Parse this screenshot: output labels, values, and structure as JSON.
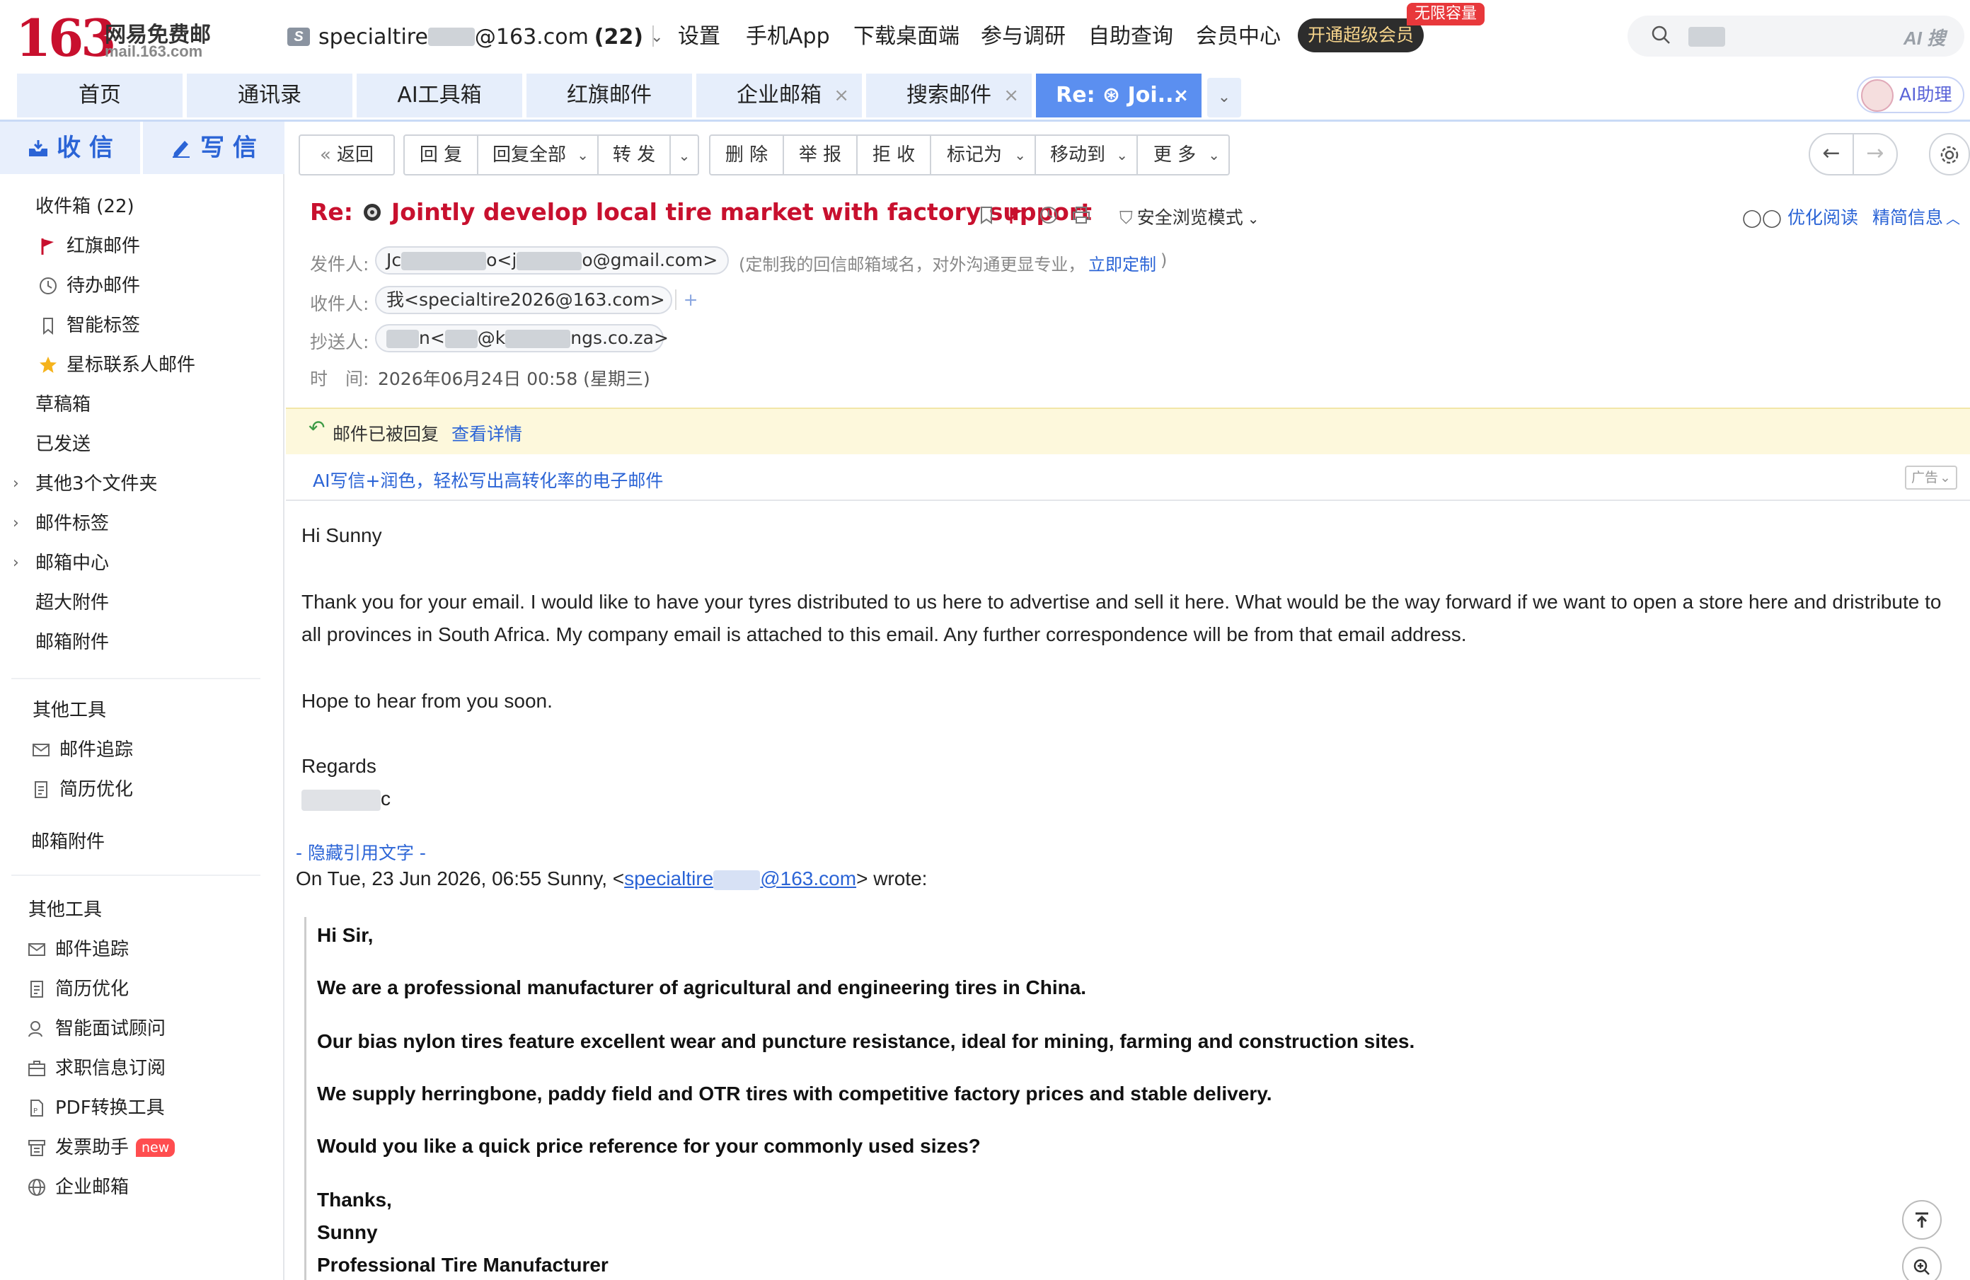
{
  "brand": {
    "logo_number": "163",
    "name": "网易免费邮",
    "url": "mail.163.com"
  },
  "account": {
    "prefix": "specialtire",
    "suffix": "@163.com",
    "count": "(22)"
  },
  "top_nav": [
    "设置",
    "手机App",
    "下载桌面端",
    "参与调研",
    "自助查询",
    "会员中心"
  ],
  "vip": {
    "button": "开通超级会员",
    "badge": "无限容量"
  },
  "search": {
    "ai_label": "AI 搜"
  },
  "tabs": [
    {
      "label": "首页"
    },
    {
      "label": "通讯录"
    },
    {
      "label": "AI工具箱"
    },
    {
      "label": "红旗邮件"
    },
    {
      "label": "企业邮箱",
      "close": "×"
    },
    {
      "label": "搜索邮件",
      "close": "×"
    },
    {
      "label": "Re: ⊛ Joi...",
      "close": "×"
    }
  ],
  "ai_helper": "AI助理",
  "sidebar": {
    "receive": "收 信",
    "write": "写 信",
    "folders": [
      {
        "label": "收件箱 (22)"
      },
      {
        "label": "红旗邮件"
      },
      {
        "label": "待办邮件"
      },
      {
        "label": "智能标签"
      },
      {
        "label": "星标联系人邮件"
      },
      {
        "label": "草稿箱"
      },
      {
        "label": "已发送"
      },
      {
        "label": "其他3个文件夹"
      },
      {
        "label": "邮件标签"
      },
      {
        "label": "邮箱中心"
      },
      {
        "label": "超大附件"
      },
      {
        "label": "邮箱附件"
      }
    ],
    "tools_title": "其他工具",
    "tools_a": [
      {
        "label": "邮件追踪"
      },
      {
        "label": "简历优化"
      }
    ],
    "attach2": "邮箱附件",
    "tools_title2": "其他工具",
    "tools_b": [
      {
        "label": "邮件追踪"
      },
      {
        "label": "简历优化"
      },
      {
        "label": "智能面试顾问"
      },
      {
        "label": "求职信息订阅"
      },
      {
        "label": "PDF转换工具"
      },
      {
        "label": "发票助手",
        "badge": "new"
      },
      {
        "label": "企业邮箱"
      }
    ]
  },
  "toolbar": {
    "back": "返回",
    "reply": "回 复",
    "reply_all": "回复全部",
    "forward": "转 发",
    "delete": "删 除",
    "report": "举 报",
    "reject": "拒 收",
    "mark": "标记为",
    "move": "移动到",
    "more": "更 多"
  },
  "mail": {
    "subject_prefix": "Re:",
    "subject": "Jointly develop local tire market with factory support",
    "safe_mode": "安全浏览模式",
    "optimize_read": "优化阅读",
    "brief_info": "精简信息",
    "from_label": "发件人:",
    "from_a": "Jc",
    "from_b": "o<j",
    "from_c": "o@gmail.com>",
    "from_note": "(定制我的回信邮箱域名，对外沟通更显专业，",
    "from_link": "立即定制",
    "from_close": ")",
    "to_label": "收件人:",
    "to_value": "我<specialtire2026@163.com>",
    "to_add": "+",
    "cc_label": "抄送人:",
    "cc_a": "n<",
    "cc_b": "@k",
    "cc_c": "ngs.co.za>",
    "time_label": "时　间:",
    "time_value": "2026年06月24日 00:58 (星期三)"
  },
  "notice": {
    "text": "邮件已被回复",
    "link": "查看详情"
  },
  "ad": {
    "text": "AI写信+润色，轻松写出高转化率的电子邮件",
    "tag": "广告"
  },
  "body": {
    "greeting": "Hi Sunny",
    "p1": "Thank you for your email. I would like to have your tyres distributed to us here to advertise and sell it here. What would be the way forward if we want to open a store here and dristribute to all provinces in South Africa. My company email is attached to this email. Any further correspondence will be from that email address.",
    "p2": "Hope to hear from you soon.",
    "regards": "Regards",
    "sig_tail": "c"
  },
  "quote": {
    "hide": "- 隐藏引用文字 -",
    "head_a": "On Tue, 23 Jun 2026, 06:55 Sunny, <",
    "link_a": "specialtire",
    "link_b": "@163.com",
    "head_b": "> wrote:",
    "lines": [
      "Hi Sir,",
      "We are a professional manufacturer of agricultural and engineering tires in China.",
      "Our bias nylon tires feature excellent wear and puncture resistance, ideal for mining, farming and construction sites.",
      "We supply herringbone, paddy field and OTR tires with competitive factory prices and stable delivery.",
      "Would you like a quick price reference for your commonly used sizes?",
      "Thanks,",
      "Sunny",
      "Professional Tire Manufacturer"
    ]
  },
  "colors": {
    "brand_red": "#c8102e",
    "accent_blue": "#2b64d6",
    "tab_active": "#5b8ff0"
  }
}
